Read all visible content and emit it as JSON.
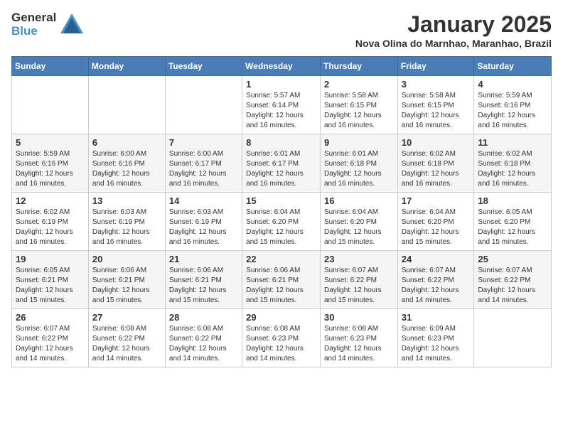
{
  "header": {
    "logo_general": "General",
    "logo_blue": "Blue",
    "month": "January 2025",
    "location": "Nova Olina do Marnhao, Maranhao, Brazil"
  },
  "weekdays": [
    "Sunday",
    "Monday",
    "Tuesday",
    "Wednesday",
    "Thursday",
    "Friday",
    "Saturday"
  ],
  "weeks": [
    [
      {
        "day": "",
        "info": ""
      },
      {
        "day": "",
        "info": ""
      },
      {
        "day": "",
        "info": ""
      },
      {
        "day": "1",
        "info": "Sunrise: 5:57 AM\nSunset: 6:14 PM\nDaylight: 12 hours\nand 16 minutes."
      },
      {
        "day": "2",
        "info": "Sunrise: 5:58 AM\nSunset: 6:15 PM\nDaylight: 12 hours\nand 16 minutes."
      },
      {
        "day": "3",
        "info": "Sunrise: 5:58 AM\nSunset: 6:15 PM\nDaylight: 12 hours\nand 16 minutes."
      },
      {
        "day": "4",
        "info": "Sunrise: 5:59 AM\nSunset: 6:16 PM\nDaylight: 12 hours\nand 16 minutes."
      }
    ],
    [
      {
        "day": "5",
        "info": "Sunrise: 5:59 AM\nSunset: 6:16 PM\nDaylight: 12 hours\nand 16 minutes."
      },
      {
        "day": "6",
        "info": "Sunrise: 6:00 AM\nSunset: 6:16 PM\nDaylight: 12 hours\nand 16 minutes."
      },
      {
        "day": "7",
        "info": "Sunrise: 6:00 AM\nSunset: 6:17 PM\nDaylight: 12 hours\nand 16 minutes."
      },
      {
        "day": "8",
        "info": "Sunrise: 6:01 AM\nSunset: 6:17 PM\nDaylight: 12 hours\nand 16 minutes."
      },
      {
        "day": "9",
        "info": "Sunrise: 6:01 AM\nSunset: 6:18 PM\nDaylight: 12 hours\nand 16 minutes."
      },
      {
        "day": "10",
        "info": "Sunrise: 6:02 AM\nSunset: 6:18 PM\nDaylight: 12 hours\nand 16 minutes."
      },
      {
        "day": "11",
        "info": "Sunrise: 6:02 AM\nSunset: 6:18 PM\nDaylight: 12 hours\nand 16 minutes."
      }
    ],
    [
      {
        "day": "12",
        "info": "Sunrise: 6:02 AM\nSunset: 6:19 PM\nDaylight: 12 hours\nand 16 minutes."
      },
      {
        "day": "13",
        "info": "Sunrise: 6:03 AM\nSunset: 6:19 PM\nDaylight: 12 hours\nand 16 minutes."
      },
      {
        "day": "14",
        "info": "Sunrise: 6:03 AM\nSunset: 6:19 PM\nDaylight: 12 hours\nand 16 minutes."
      },
      {
        "day": "15",
        "info": "Sunrise: 6:04 AM\nSunset: 6:20 PM\nDaylight: 12 hours\nand 15 minutes."
      },
      {
        "day": "16",
        "info": "Sunrise: 6:04 AM\nSunset: 6:20 PM\nDaylight: 12 hours\nand 15 minutes."
      },
      {
        "day": "17",
        "info": "Sunrise: 6:04 AM\nSunset: 6:20 PM\nDaylight: 12 hours\nand 15 minutes."
      },
      {
        "day": "18",
        "info": "Sunrise: 6:05 AM\nSunset: 6:20 PM\nDaylight: 12 hours\nand 15 minutes."
      }
    ],
    [
      {
        "day": "19",
        "info": "Sunrise: 6:05 AM\nSunset: 6:21 PM\nDaylight: 12 hours\nand 15 minutes."
      },
      {
        "day": "20",
        "info": "Sunrise: 6:06 AM\nSunset: 6:21 PM\nDaylight: 12 hours\nand 15 minutes."
      },
      {
        "day": "21",
        "info": "Sunrise: 6:06 AM\nSunset: 6:21 PM\nDaylight: 12 hours\nand 15 minutes."
      },
      {
        "day": "22",
        "info": "Sunrise: 6:06 AM\nSunset: 6:21 PM\nDaylight: 12 hours\nand 15 minutes."
      },
      {
        "day": "23",
        "info": "Sunrise: 6:07 AM\nSunset: 6:22 PM\nDaylight: 12 hours\nand 15 minutes."
      },
      {
        "day": "24",
        "info": "Sunrise: 6:07 AM\nSunset: 6:22 PM\nDaylight: 12 hours\nand 14 minutes."
      },
      {
        "day": "25",
        "info": "Sunrise: 6:07 AM\nSunset: 6:22 PM\nDaylight: 12 hours\nand 14 minutes."
      }
    ],
    [
      {
        "day": "26",
        "info": "Sunrise: 6:07 AM\nSunset: 6:22 PM\nDaylight: 12 hours\nand 14 minutes."
      },
      {
        "day": "27",
        "info": "Sunrise: 6:08 AM\nSunset: 6:22 PM\nDaylight: 12 hours\nand 14 minutes."
      },
      {
        "day": "28",
        "info": "Sunrise: 6:08 AM\nSunset: 6:22 PM\nDaylight: 12 hours\nand 14 minutes."
      },
      {
        "day": "29",
        "info": "Sunrise: 6:08 AM\nSunset: 6:23 PM\nDaylight: 12 hours\nand 14 minutes."
      },
      {
        "day": "30",
        "info": "Sunrise: 6:08 AM\nSunset: 6:23 PM\nDaylight: 12 hours\nand 14 minutes."
      },
      {
        "day": "31",
        "info": "Sunrise: 6:09 AM\nSunset: 6:23 PM\nDaylight: 12 hours\nand 14 minutes."
      },
      {
        "day": "",
        "info": ""
      }
    ]
  ]
}
